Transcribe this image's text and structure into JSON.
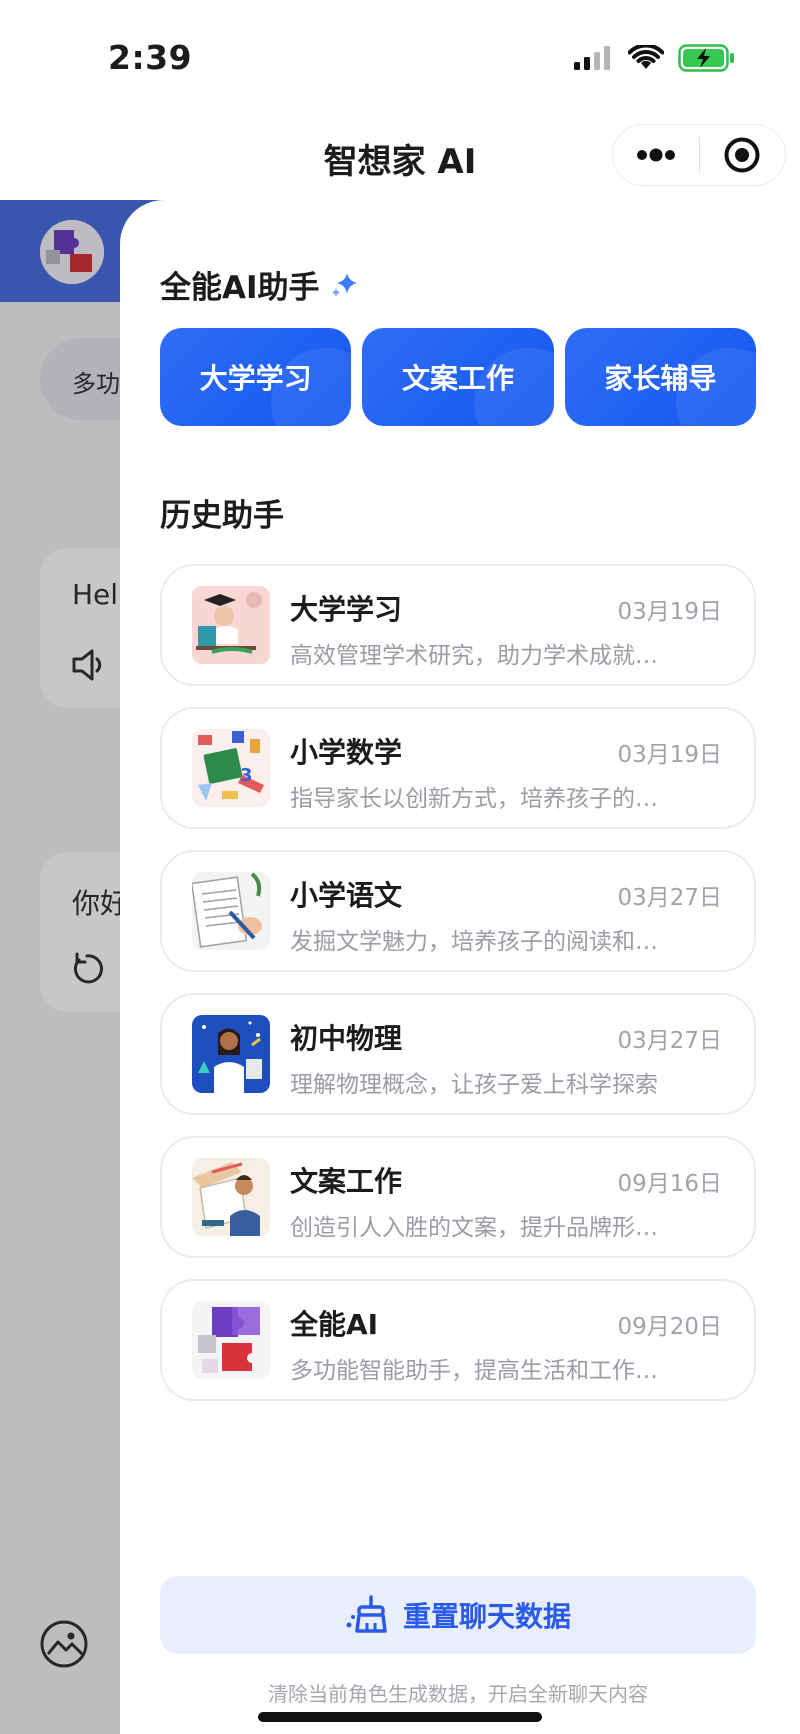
{
  "status_bar": {
    "time": "2:39"
  },
  "nav": {
    "title": "智想家 AI",
    "more_icon": "more-dots-icon",
    "close_icon": "target-icon"
  },
  "background": {
    "chip_label": "多功",
    "card1_text": "Hell",
    "card2_text": "你好",
    "card2_action": "重"
  },
  "drawer": {
    "section1_title": "全能AI助手",
    "quick_buttons": [
      {
        "label": "大学学习"
      },
      {
        "label": "文案工作"
      },
      {
        "label": "家长辅导"
      }
    ],
    "section2_title": "历史助手",
    "history": [
      {
        "name": "大学学习",
        "date": "03月19日",
        "desc": "高效管理学术研究，助力学术成就…"
      },
      {
        "name": "小学数学",
        "date": "03月19日",
        "desc": "指导家长以创新方式，培养孩子的…"
      },
      {
        "name": "小学语文",
        "date": "03月27日",
        "desc": "发掘文学魅力，培养孩子的阅读和…"
      },
      {
        "name": "初中物理",
        "date": "03月27日",
        "desc": "理解物理概念，让孩子爱上科学探索"
      },
      {
        "name": "文案工作",
        "date": "09月16日",
        "desc": "创造引人入胜的文案，提升品牌形…"
      },
      {
        "name": "全能AI",
        "date": "09月20日",
        "desc": "多功能智能助手，提高生活和工作…"
      }
    ],
    "reset_label": "重置聊天数据",
    "reset_hint": "清除当前角色生成数据，开启全新聊天内容"
  },
  "colors": {
    "primary": "#1557f0",
    "accent_light": "#e8eefc",
    "header_blue": "#4a6fe0"
  }
}
